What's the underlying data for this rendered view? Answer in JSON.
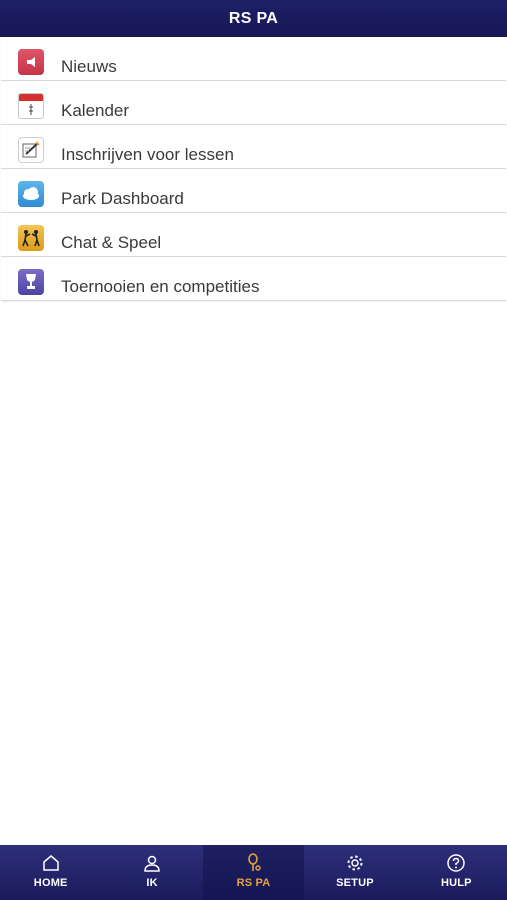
{
  "header": {
    "title": "RS PA"
  },
  "menu": {
    "items": [
      {
        "label": "Nieuws",
        "icon": "megaphone-icon"
      },
      {
        "label": "Kalender",
        "icon": "calendar-icon"
      },
      {
        "label": "Inschrijven voor lessen",
        "icon": "signup-icon"
      },
      {
        "label": "Park Dashboard",
        "icon": "weather-icon"
      },
      {
        "label": "Chat & Speel",
        "icon": "players-icon"
      },
      {
        "label": "Toernooien en competities",
        "icon": "trophy-icon"
      }
    ]
  },
  "tabbar": {
    "tabs": [
      {
        "label": "HOME",
        "icon": "home-icon",
        "active": false
      },
      {
        "label": "IK",
        "icon": "user-icon",
        "active": false
      },
      {
        "label": "RS PA",
        "icon": "racket-icon",
        "active": true
      },
      {
        "label": "SETUP",
        "icon": "gear-icon",
        "active": false
      },
      {
        "label": "HULP",
        "icon": "help-icon",
        "active": false
      }
    ]
  },
  "colors": {
    "header_bg": "#1e1f66",
    "tabbar_bg": "#23246a",
    "active_tab_label": "#e8a13b"
  }
}
